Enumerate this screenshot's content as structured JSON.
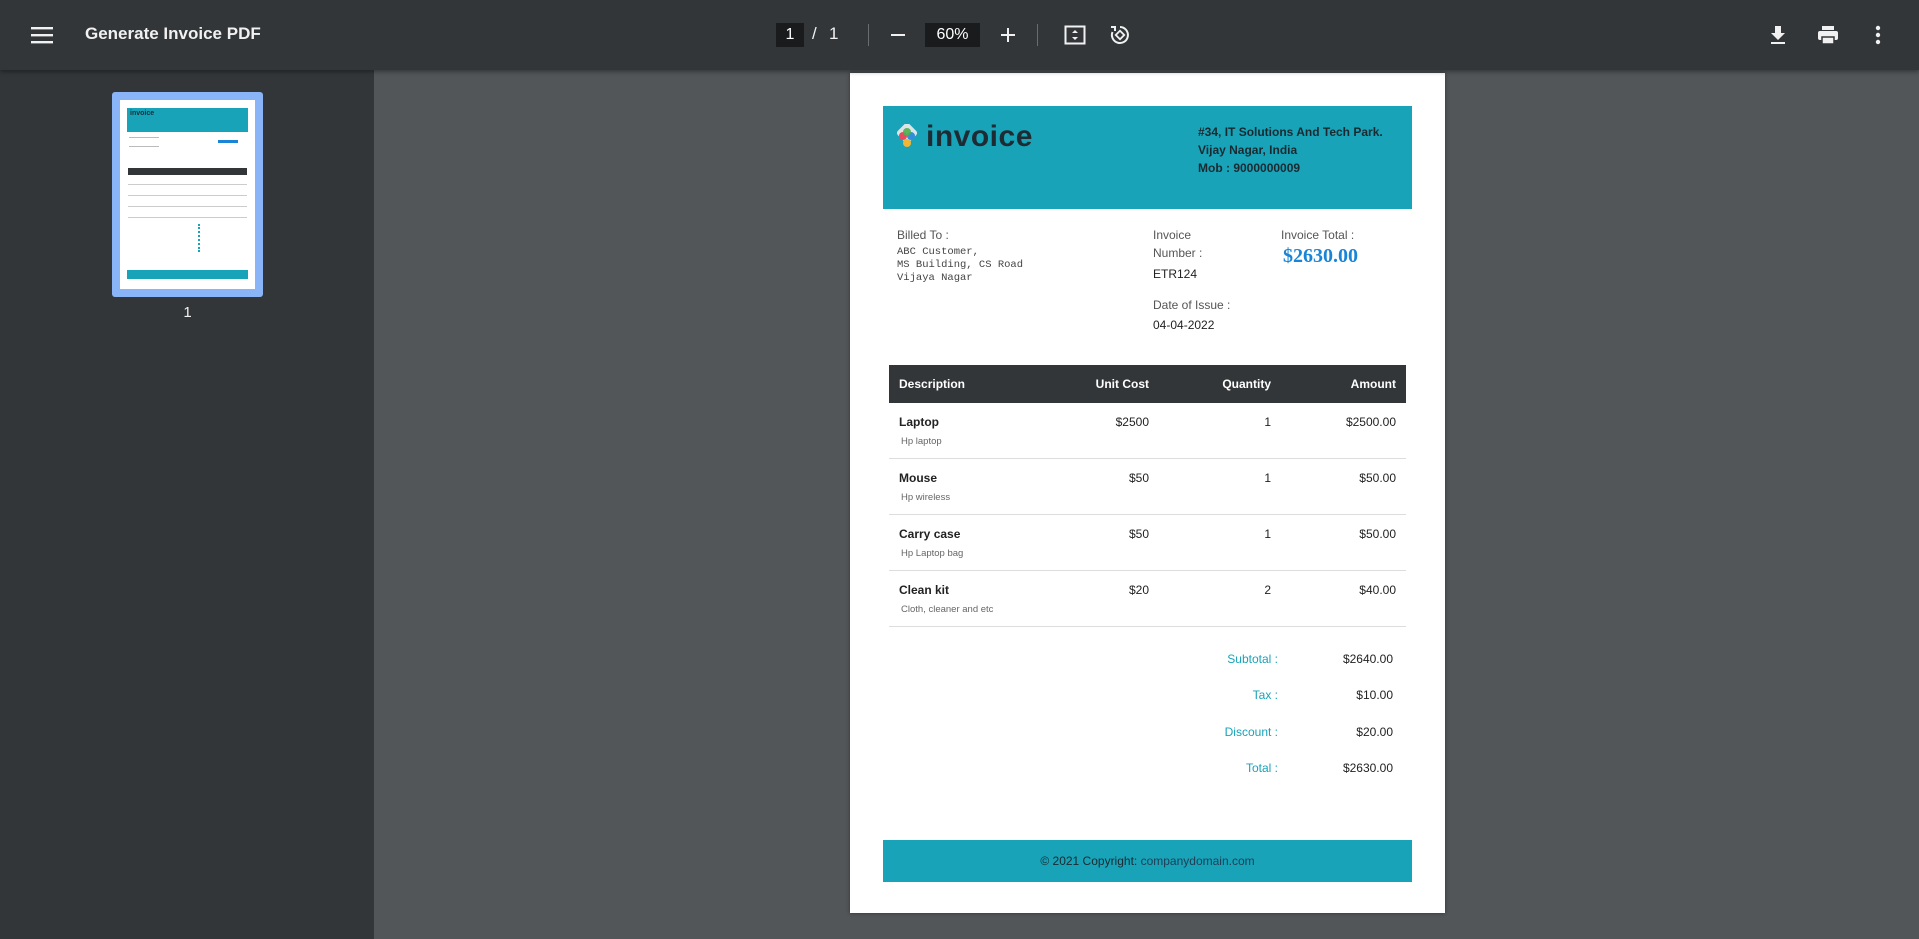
{
  "toolbar": {
    "title": "Generate Invoice PDF",
    "current_page": "1",
    "page_separator": "/",
    "total_pages": "1",
    "zoom": "60%"
  },
  "sidebar": {
    "thumbnail_label": "1",
    "thumb_logo": "invoice"
  },
  "invoice": {
    "logo_text": "invoice",
    "company_address": [
      "#34, IT Solutions And Tech Park.",
      "Vijay Nagar, India",
      "Mob : 9000000009"
    ],
    "billed_to_label": "Billed To :",
    "billed_to_lines": "ABC Customer,\nMS Building, CS Road\nVijaya Nagar",
    "invoice_number_label_1": "Invoice",
    "invoice_number_label_2": "Number :",
    "invoice_number": "ETR124",
    "date_label": "Date of Issue :",
    "date": "04-04-2022",
    "total_label": "Invoice Total :",
    "total_amount": "$2630.00",
    "table": {
      "headers": [
        "Description",
        "Unit Cost",
        "Quantity",
        "Amount"
      ],
      "rows": [
        {
          "name": "Laptop",
          "sub": "Hp laptop",
          "unit": "$2500",
          "qty": "1",
          "amount": "$2500.00"
        },
        {
          "name": "Mouse",
          "sub": "Hp wireless",
          "unit": "$50",
          "qty": "1",
          "amount": "$50.00"
        },
        {
          "name": "Carry case",
          "sub": "Hp Laptop bag",
          "unit": "$50",
          "qty": "1",
          "amount": "$50.00"
        },
        {
          "name": "Clean kit",
          "sub": "Cloth, cleaner and etc",
          "unit": "$20",
          "qty": "2",
          "amount": "$40.00"
        }
      ]
    },
    "totals": [
      {
        "label": "Subtotal :",
        "value": "$2640.00"
      },
      {
        "label": "Tax :",
        "value": "$10.00"
      },
      {
        "label": "Discount :",
        "value": "$20.00"
      },
      {
        "label": "Total :",
        "value": "$2630.00"
      }
    ],
    "footer_text": "© 2021 Copyright: ",
    "footer_link": "companydomain.com"
  },
  "colors": {
    "toolbar_bg": "#323639",
    "viewer_bg": "#525659",
    "accent": "#18a3b9",
    "total_blue": "#1a85d6",
    "thumb_selected": "#8ab4f8"
  }
}
